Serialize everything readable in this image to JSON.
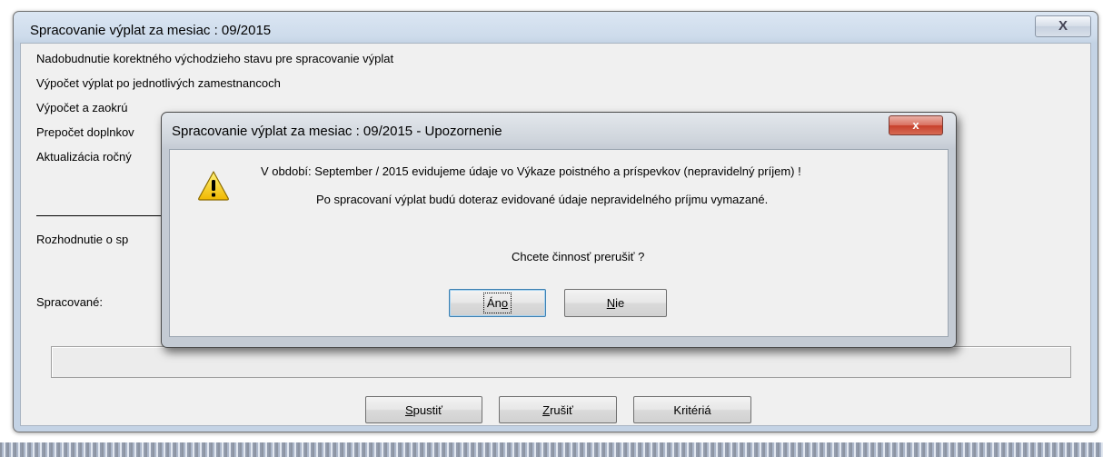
{
  "main_window": {
    "title": "Spracovanie výplat za mesiac : 09/2015",
    "close_glyph": "X",
    "lines": [
      "Nadobudnutie korektného východzieho stavu pre spracovanie výplat",
      "Výpočet výplat po jednotlivých zamestnancoch",
      "Výpočet a zaokrú",
      "Prepočet doplnkov",
      "Aktualizácia ročný"
    ],
    "decision_label": "Rozhodnutie o sp",
    "processed_label": "Spracované:",
    "buttons": {
      "start": {
        "mnemonic": "S",
        "rest": "pustiť"
      },
      "cancel": {
        "mnemonic": "Z",
        "rest": "rušiť"
      },
      "criteria": "Kritériá"
    }
  },
  "alert": {
    "title": "Spracovanie výplat za mesiac : 09/2015 - Upozornenie",
    "close_glyph": "x",
    "icon": "warning-triangle-icon",
    "message_line1": "V období: September / 2015 evidujeme údaje vo Výkaze poistného a príspevkov (nepravidelný príjem) !",
    "message_line2": "Po spracovaní výplat budú doteraz evidované údaje nepravidelného príjmu vymazané.",
    "question": "Chcete činnosť prerušiť ?",
    "buttons": {
      "yes": {
        "before": "Án",
        "mnemonic": "o"
      },
      "no": {
        "mnemonic": "N",
        "rest": "ie"
      }
    }
  },
  "colors": {
    "window_frame": "#cddbeb",
    "client_bg": "#f0f0f0",
    "alert_close": "#c7402c",
    "warning_yellow": "#f5d21a"
  }
}
